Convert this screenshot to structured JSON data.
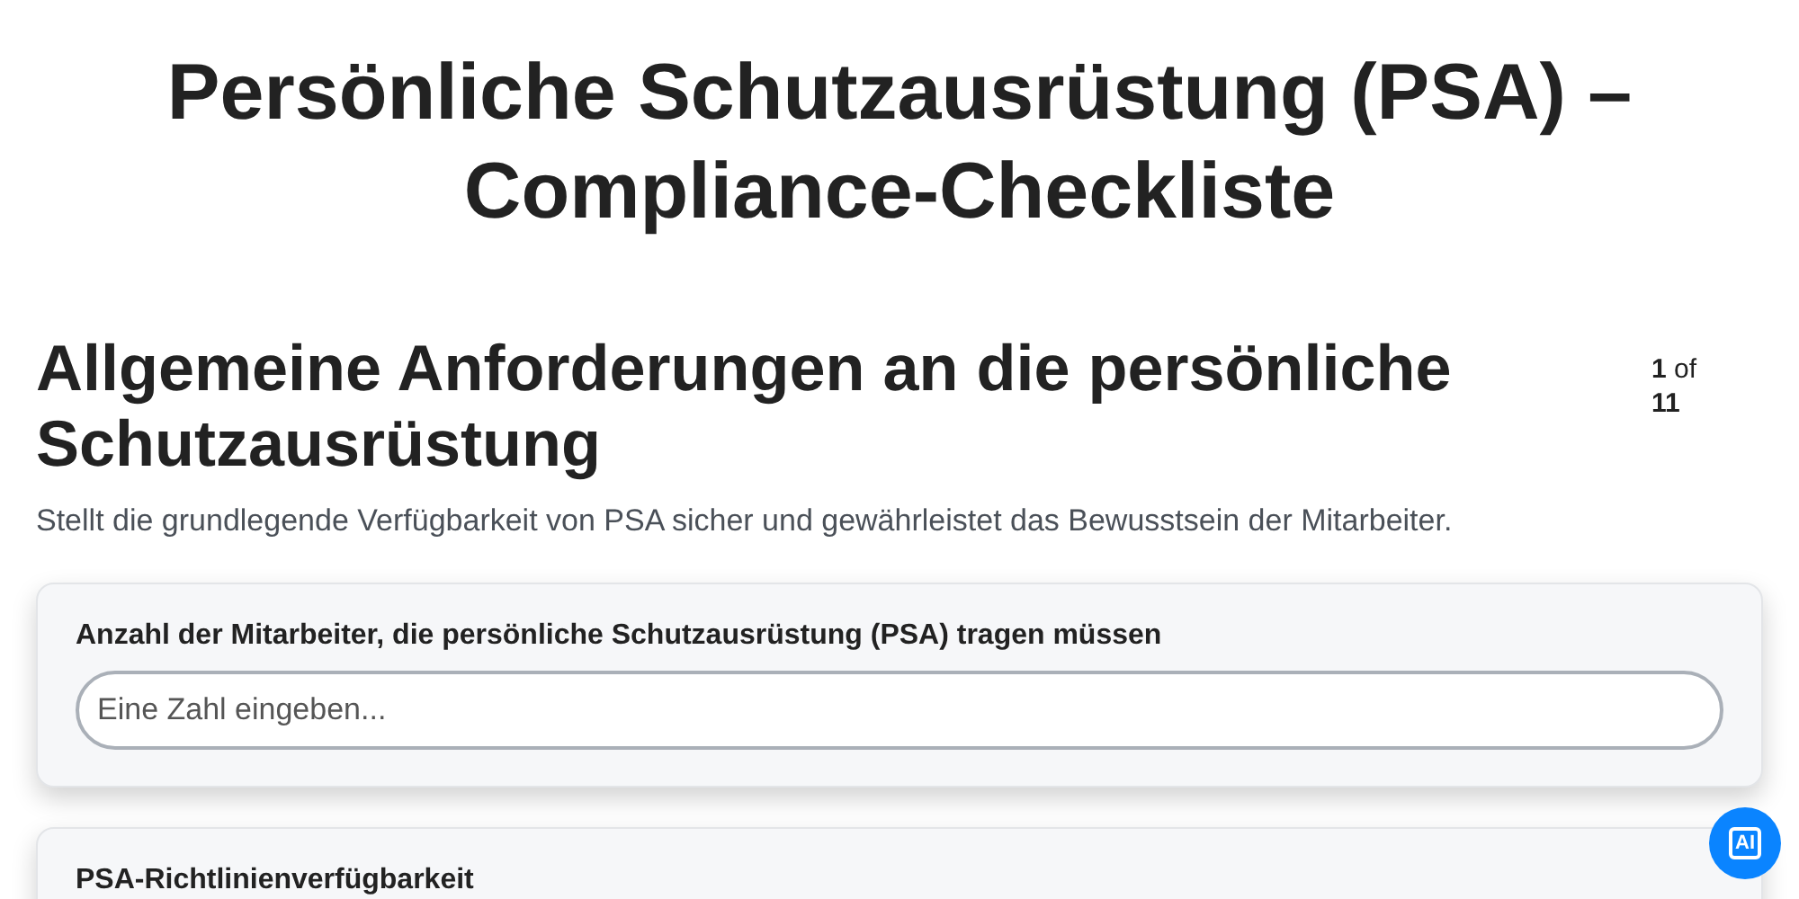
{
  "title": "Persönliche Schutzausrüstung (PSA) – Compliance-Checkliste",
  "section": {
    "heading": "Allgemeine Anforderungen an die persönliche Schutzausrüstung",
    "counter": "**1** of **11**",
    "description": "Stellt die grundlegende Verfügbarkeit von PSA sicher und gewährleistet das Bewusstsein der Mitarbeiter."
  },
  "questions": [
    {
      "label": "Anzahl der Mitarbeiter, die persönliche Schutzausrüstung (PSA) tragen müssen",
      "kind": "number",
      "placeholder": "Eine Zahl eingeben..."
    },
    {
      "label": "PSA-Richtlinienverfügbarkeit",
      "kind": "text"
    }
  ],
  "assistant_button": {
    "label": "AI"
  }
}
